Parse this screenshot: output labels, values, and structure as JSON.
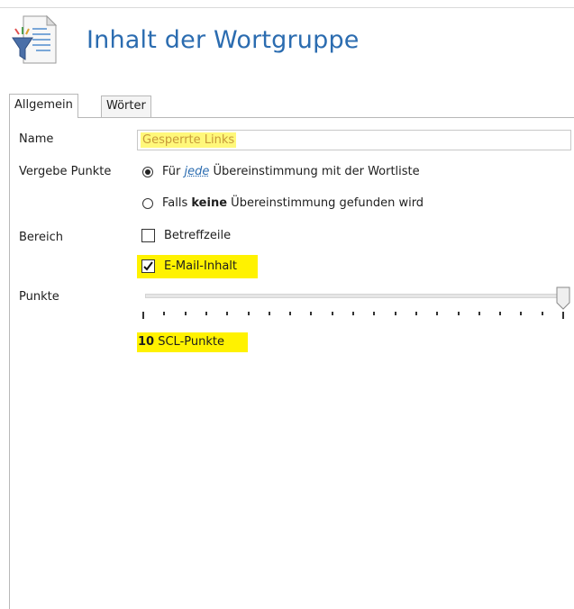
{
  "header": {
    "title": "Inhalt der Wortgruppe",
    "icon": "funnel-document-icon"
  },
  "tabs": [
    {
      "label": "Allgemein",
      "active": true
    },
    {
      "label": "Wörter",
      "active": false
    }
  ],
  "form": {
    "name": {
      "label": "Name",
      "value": "Gesperrte Links"
    },
    "vergebe_punkte": {
      "label": "Vergebe Punkte",
      "option1": {
        "prefix": "Für ",
        "emphasis": "jede",
        "suffix": " Übereinstimmung mit der Wortliste",
        "selected": true
      },
      "option2": {
        "prefix": "Falls ",
        "bold": "keine",
        "suffix": " Übereinstimmung gefunden wird",
        "selected": false
      }
    },
    "bereich": {
      "label": "Bereich",
      "betreffzeile": {
        "label": "Betreffzeile",
        "checked": false
      },
      "email_inhalt": {
        "label": "E-Mail-Inhalt",
        "checked": true
      }
    },
    "punkte": {
      "label": "Punkte",
      "value": 10,
      "max": 10,
      "value_text": "10",
      "unit_text": " SCL-Punkte"
    }
  },
  "colors": {
    "title": "#2b6cb0",
    "highlight": "#fff200",
    "name_highlight": "#fff87a"
  }
}
